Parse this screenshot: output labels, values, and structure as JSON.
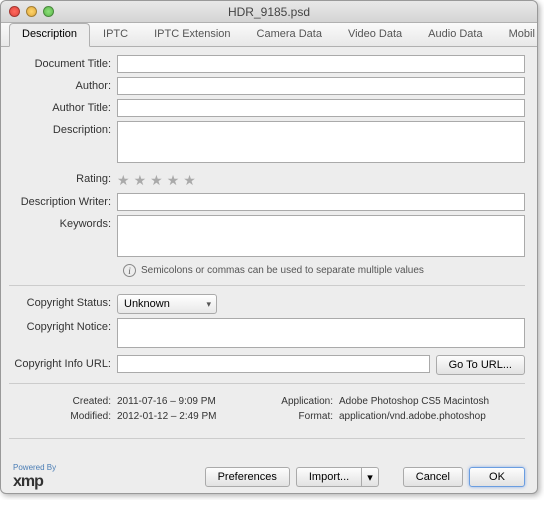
{
  "window": {
    "title": "HDR_9185.psd"
  },
  "tabs": {
    "items": [
      {
        "label": "Description"
      },
      {
        "label": "IPTC"
      },
      {
        "label": "IPTC Extension"
      },
      {
        "label": "Camera Data"
      },
      {
        "label": "Video Data"
      },
      {
        "label": "Audio Data"
      },
      {
        "label": "Mobil"
      }
    ]
  },
  "fields": {
    "documentTitle": {
      "label": "Document Title:",
      "value": ""
    },
    "author": {
      "label": "Author:",
      "value": ""
    },
    "authorTitle": {
      "label": "Author Title:",
      "value": ""
    },
    "description": {
      "label": "Description:",
      "value": ""
    },
    "rating": {
      "label": "Rating:"
    },
    "descriptionWriter": {
      "label": "Description Writer:",
      "value": ""
    },
    "keywords": {
      "label": "Keywords:",
      "value": ""
    },
    "copyrightStatus": {
      "label": "Copyright Status:",
      "value": "Unknown"
    },
    "copyrightNotice": {
      "label": "Copyright Notice:",
      "value": ""
    },
    "copyrightUrl": {
      "label": "Copyright Info URL:",
      "value": ""
    }
  },
  "hint": "Semicolons or commas can be used to separate multiple values",
  "meta": {
    "created": {
      "label": "Created:",
      "value": "2011-07-16 – 9:09 PM"
    },
    "modified": {
      "label": "Modified:",
      "value": "2012-01-12 – 2:49 PM"
    },
    "application": {
      "label": "Application:",
      "value": "Adobe Photoshop CS5 Macintosh"
    },
    "format": {
      "label": "Format:",
      "value": "application/vnd.adobe.photoshop"
    }
  },
  "buttons": {
    "goToUrl": "Go To URL...",
    "preferences": "Preferences",
    "import": "Import...",
    "cancel": "Cancel",
    "ok": "OK"
  },
  "xmp": {
    "poweredBy": "Powered By",
    "logo": "xmp"
  }
}
